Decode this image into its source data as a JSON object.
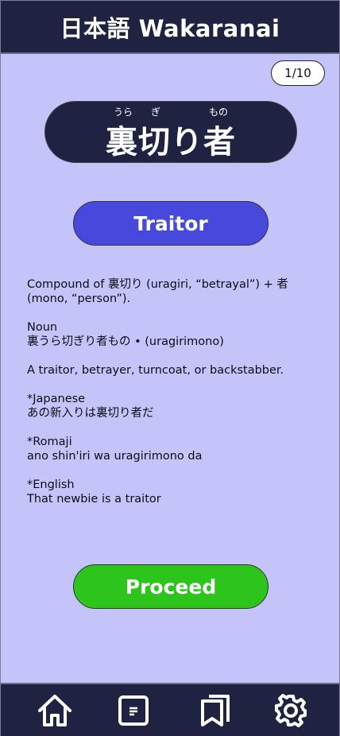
{
  "header": {
    "title": "日本語 Wakaranai"
  },
  "progress": {
    "counter": "1/10"
  },
  "word": {
    "furigana": [
      "うら",
      "ぎ",
      "もの"
    ],
    "kanji": "裏切り者",
    "meaning": "Traitor"
  },
  "definition": {
    "etymology": "Compound of 裏切り (uragiri, “betrayal”) + 者 (mono, “person”).",
    "pos": "Noun",
    "reading": "裏うら切ぎり者もの • (uragirimono)",
    "gloss": "A traitor, betrayer, turncoat, or backstabber.",
    "japanese_label": "*Japanese",
    "japanese_example": "あの新入りは裏切り者だ",
    "romaji_label": "*Romaji",
    "romaji_example": "ano shin'iri wa uragirimono da",
    "english_label": "*English",
    "english_example": "That newbie is a traitor"
  },
  "actions": {
    "proceed_label": "Proceed"
  },
  "nav": {
    "items": [
      {
        "icon": "home-icon"
      },
      {
        "icon": "document-icon"
      },
      {
        "icon": "bookmarks-icon"
      },
      {
        "icon": "gear-icon"
      }
    ]
  },
  "colors": {
    "background": "#c4c4fb",
    "header": "#1f2240",
    "meaning_button": "#4749dd",
    "proceed_button": "#2dc51c"
  }
}
